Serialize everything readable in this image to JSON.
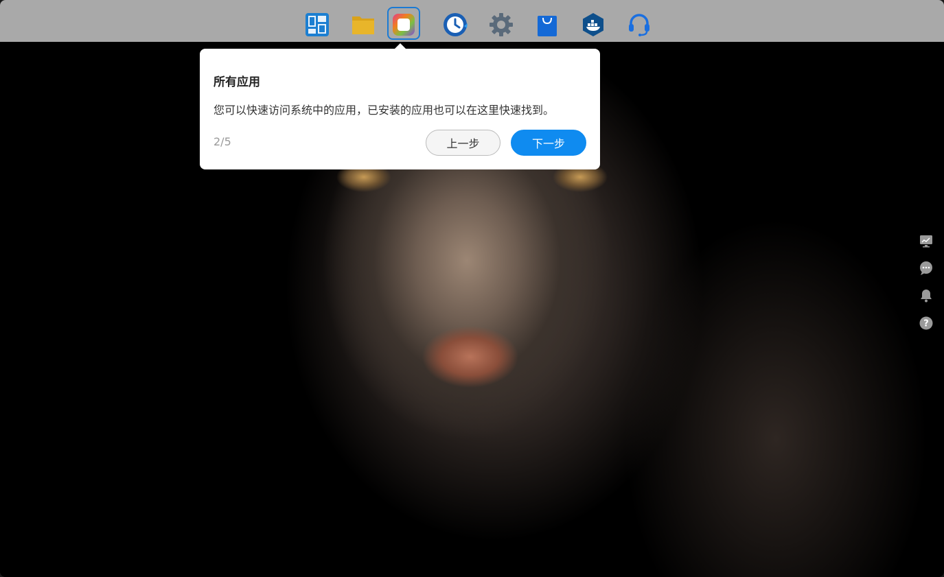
{
  "dock": {
    "items": [
      {
        "name": "dashboard-app",
        "icon": "grid-window-icon"
      },
      {
        "name": "file-manager-app",
        "icon": "folder-icon"
      },
      {
        "name": "all-apps",
        "icon": "apps-square-icon",
        "active": true
      },
      {
        "name": "backup-app",
        "icon": "clock-history-icon"
      },
      {
        "name": "settings-app",
        "icon": "gear-icon"
      },
      {
        "name": "app-store",
        "icon": "shopping-bag-icon"
      },
      {
        "name": "docker-app",
        "icon": "docker-hexagon-icon"
      },
      {
        "name": "support-app",
        "icon": "headset-icon"
      }
    ]
  },
  "side_tools": [
    {
      "name": "resource-monitor",
      "icon": "monitor-chart-icon"
    },
    {
      "name": "messages",
      "icon": "chat-bubble-icon"
    },
    {
      "name": "notifications",
      "icon": "bell-icon"
    },
    {
      "name": "help",
      "icon": "help-circle-icon"
    }
  ],
  "tour": {
    "title": "所有应用",
    "description": "您可以快速访问系统中的应用，已安装的应用也可以在这里快速找到。",
    "step": "2/5",
    "prev_label": "上一步",
    "next_label": "下一步"
  },
  "colors": {
    "taskbar": "#a9a9a9",
    "accent": "#0f8bf0",
    "active_frame": "#1a7ad4"
  }
}
